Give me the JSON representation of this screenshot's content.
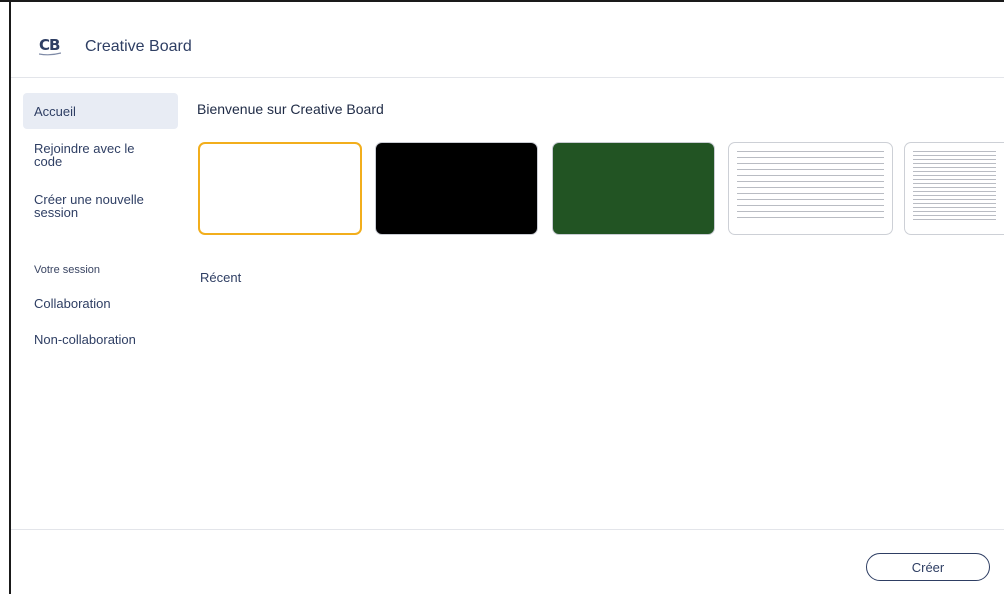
{
  "header": {
    "logo_text": "CB",
    "app_title": "Creative Board"
  },
  "sidebar": {
    "items": [
      {
        "label": "Accueil",
        "active": true
      },
      {
        "label": "Rejoindre avec le code"
      },
      {
        "label": "Créer une nouvelle session"
      }
    ],
    "section_label": "Votre session",
    "session_items": [
      {
        "label": "Collaboration"
      },
      {
        "label": "Non-collaboration"
      }
    ]
  },
  "main": {
    "welcome_title": "Bienvenue sur Creative Board",
    "templates": [
      {
        "name": "white-board",
        "color": "#ffffff",
        "selected": true
      },
      {
        "name": "black-board",
        "color": "#000000"
      },
      {
        "name": "green-board",
        "color": "#225423"
      },
      {
        "name": "lined-board",
        "color": "#ffffff"
      },
      {
        "name": "dense-lined-board",
        "color": "#ffffff"
      }
    ],
    "recent_label": "Récent"
  },
  "footer": {
    "create_label": "Créer"
  },
  "colors": {
    "accent": "#2e3e63",
    "selected_border": "#f2ae1c",
    "active_nav_bg": "#e8ecf4"
  }
}
